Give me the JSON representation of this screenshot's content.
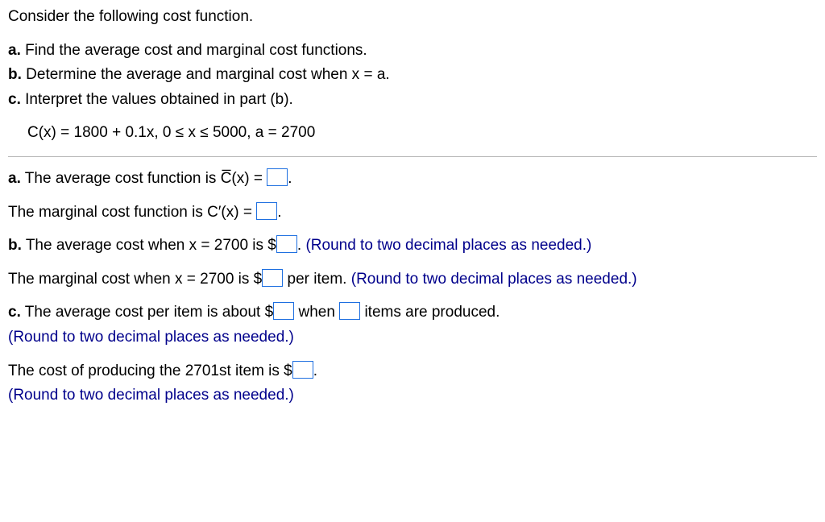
{
  "intro": "Consider the following cost function.",
  "parts_desc": {
    "a_label": "a.",
    "a_text": " Find the average cost and marginal cost functions.",
    "b_label": "b.",
    "b_text": " Determine the average and marginal cost when x = a.",
    "c_label": "c.",
    "c_text": " Interpret the values obtained in part (b)."
  },
  "equation": "C(x) = 1800 + 0.1x, 0 ≤ x ≤ 5000, a = 2700",
  "a": {
    "label": "a.",
    "avg_pre": " The average cost function is C̅(x) = ",
    "avg_post": ".",
    "marg_pre": "The marginal cost function is C′(x) = ",
    "marg_post": "."
  },
  "b": {
    "label": "b.",
    "avg_pre": " The average cost when x = 2700 is $",
    "avg_post": ". ",
    "round_hint": "(Round to two decimal places as needed.)",
    "marg_pre": "The marginal cost when x = 2700 is $",
    "marg_mid": " per item. "
  },
  "c": {
    "label": "c.",
    "avg_pre": " The average cost per item is about $",
    "avg_mid": " when ",
    "avg_post": " items are produced.",
    "round_hint": "(Round to two decimal places as needed.)",
    "next_pre": "The cost of producing the 2701st item is $",
    "next_post": "."
  }
}
